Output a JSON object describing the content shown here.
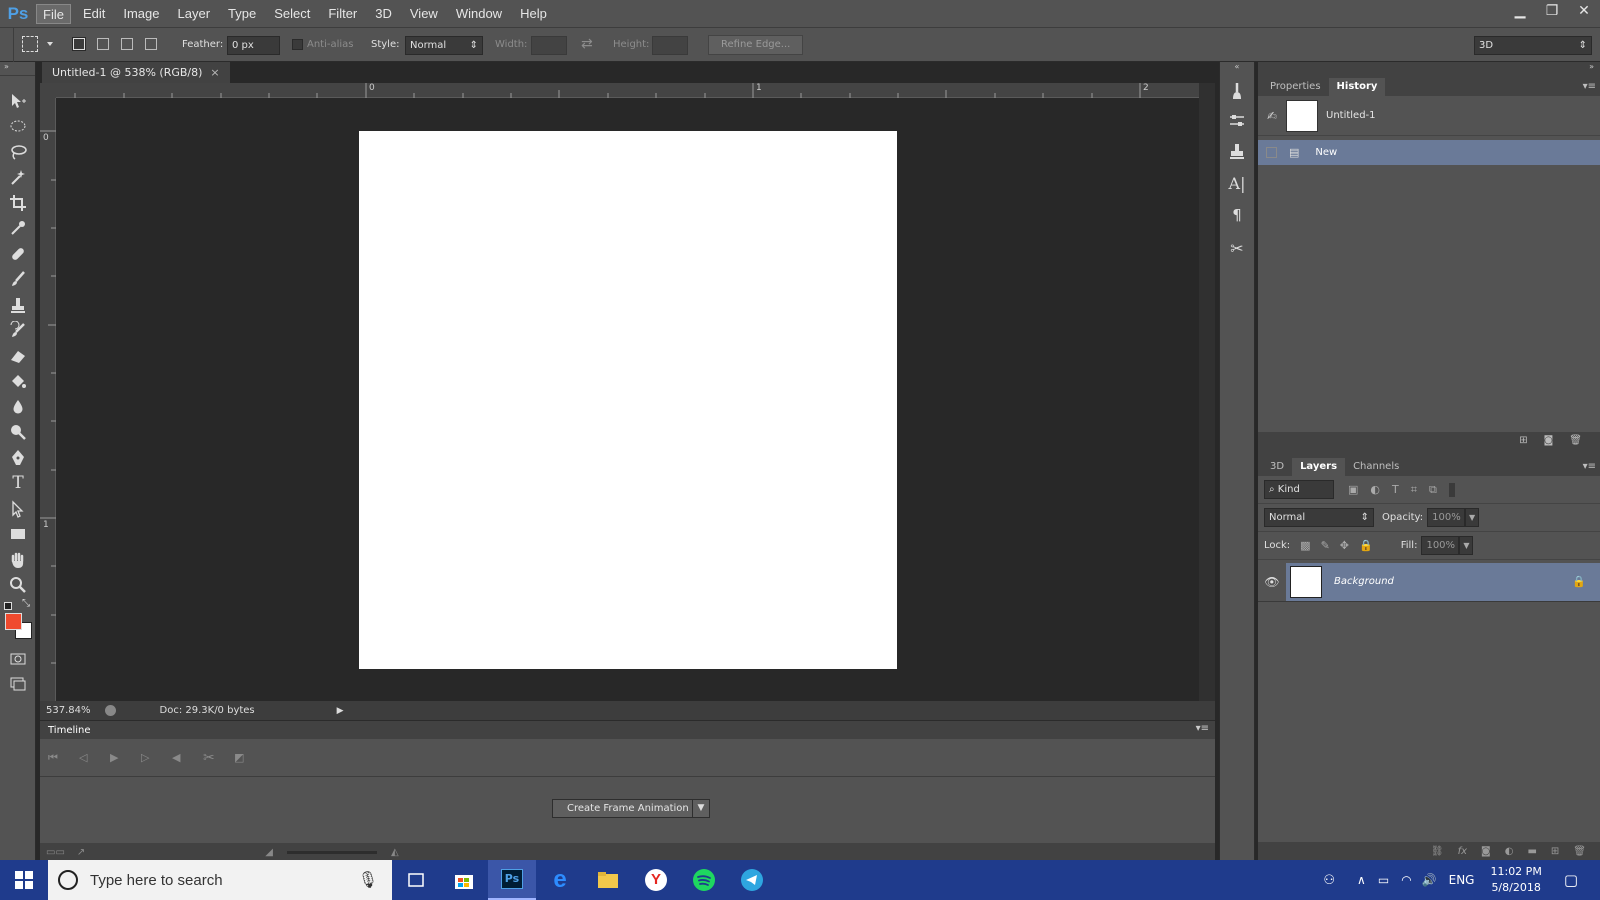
{
  "app": {
    "logo": "Ps"
  },
  "menu": [
    "File",
    "Edit",
    "Image",
    "Layer",
    "Type",
    "Select",
    "Filter",
    "3D",
    "View",
    "Window",
    "Help"
  ],
  "window_controls": {
    "minimize": "▁",
    "restore": "❐",
    "close": "✕"
  },
  "options": {
    "feather_label": "Feather:",
    "feather_value": "0 px",
    "antialias_label": "Anti-alias",
    "style_label": "Style:",
    "style_value": "Normal",
    "width_label": "Width:",
    "height_label": "Height:",
    "refine_edge": "Refine Edge...",
    "workspace": "3D"
  },
  "document": {
    "tab_title": "Untitled-1 @ 538% (RGB/8)",
    "tab_close": "×",
    "ruler_h": [
      "0",
      "1",
      "2"
    ],
    "ruler_v": [
      "0",
      "1"
    ],
    "zoom": "537.84%",
    "doc_info": "Doc: 29.3K/0 bytes"
  },
  "timeline": {
    "title": "Timeline",
    "create_button": "Create Frame Animation"
  },
  "history_panel": {
    "tabs": [
      "Properties",
      "History"
    ],
    "active_tab": "History",
    "snapshot": "Untitled-1",
    "items": [
      "New"
    ]
  },
  "layers_panel": {
    "tabs": [
      "3D",
      "Layers",
      "Channels"
    ],
    "active_tab": "Layers",
    "filter_kind": "Kind",
    "blend_mode": "Normal",
    "opacity_label": "Opacity:",
    "opacity_value": "100%",
    "lock_label": "Lock:",
    "fill_label": "Fill:",
    "fill_value": "100%",
    "layers": [
      {
        "name": "Background",
        "locked": true,
        "visible": true
      }
    ]
  },
  "colors": {
    "foreground": "#f04a2e",
    "background": "#ffffff",
    "accent": "#4fa0e6"
  },
  "taskbar": {
    "search_placeholder": "Type here to search",
    "language": "ENG",
    "time": "11:02 PM",
    "date": "5/8/2018"
  }
}
